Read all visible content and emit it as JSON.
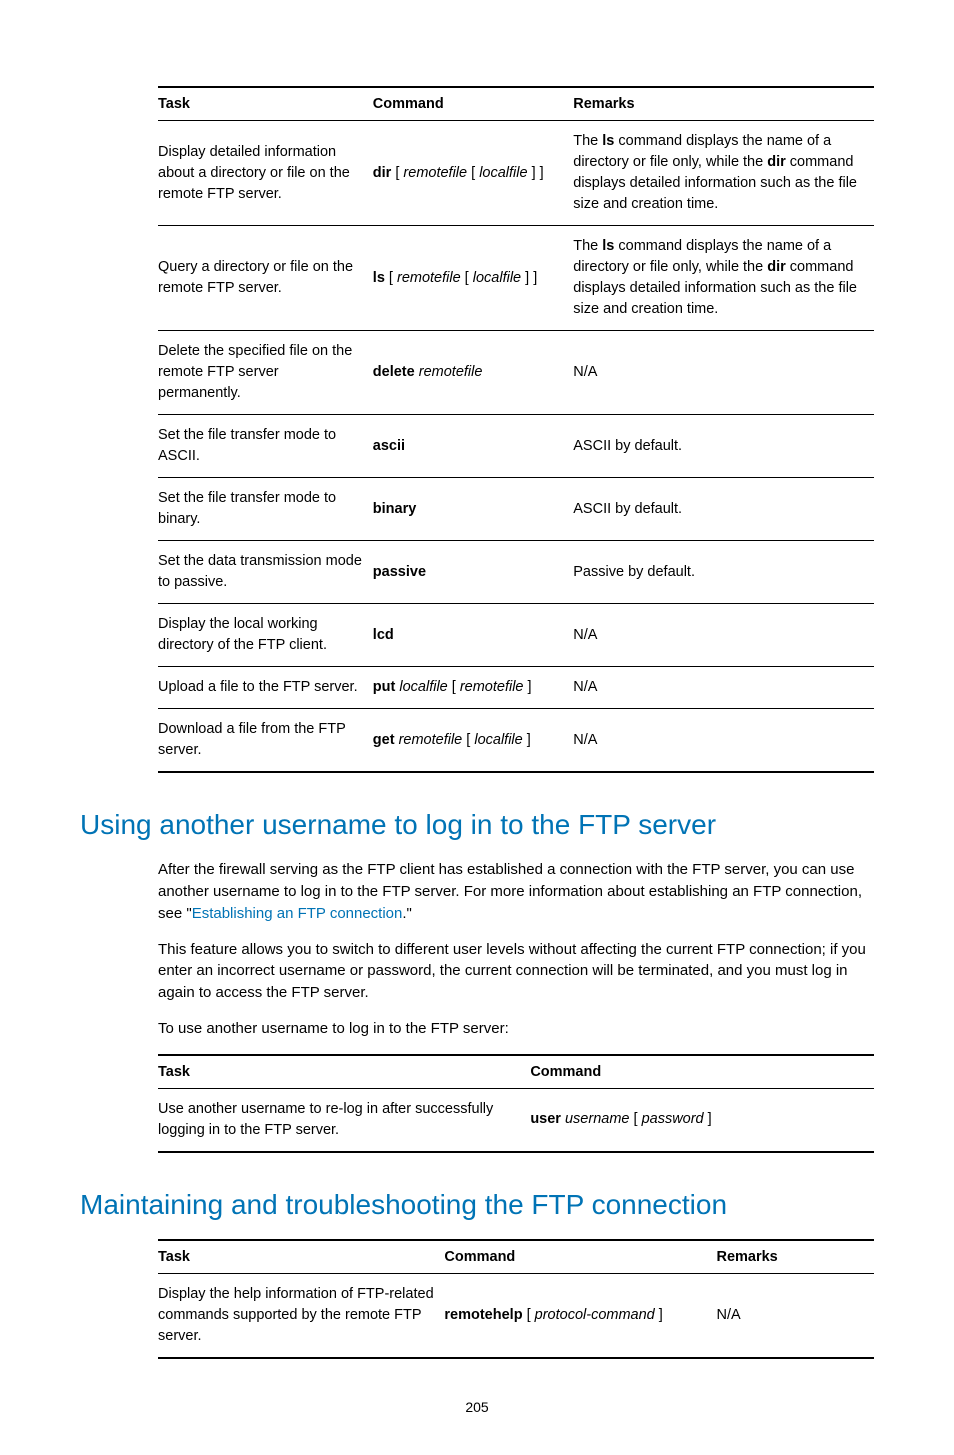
{
  "table1": {
    "headers": [
      "Task",
      "Command",
      "Remarks"
    ],
    "rows": [
      {
        "task": "Display detailed information about a directory or file on the remote FTP server.",
        "cmd_bold": "dir",
        "cmd_rest_html": " [ <span class=\"ital\">remotefile</span> [ <span class=\"ital\">localfile</span> ] ]",
        "remarks_html": "The <span class=\"bold\">ls</span> command displays the name of a directory or file only, while the <span class=\"bold\">dir</span> command displays detailed information such as the file size and creation time."
      },
      {
        "task": "Query a directory or file on the remote FTP server.",
        "cmd_bold": "ls",
        "cmd_rest_html": " [ <span class=\"ital\">remotefile</span> [ <span class=\"ital\">localfile</span> ] ]",
        "remarks_html": "The <span class=\"bold\">ls</span> command displays the name of a directory or file only, while the <span class=\"bold\">dir</span> command displays detailed information such as the file size and creation time."
      },
      {
        "task": "Delete the specified file on the remote FTP server permanently.",
        "cmd_bold": "delete",
        "cmd_rest_html": " <span class=\"ital\">remotefile</span>",
        "remarks_html": "N/A"
      },
      {
        "task": "Set the file transfer mode to ASCII.",
        "cmd_bold": "ascii",
        "cmd_rest_html": "",
        "remarks_html": "ASCII by default."
      },
      {
        "task": "Set the file transfer mode to binary.",
        "cmd_bold": "binary",
        "cmd_rest_html": "",
        "remarks_html": "ASCII by default."
      },
      {
        "task": "Set the data transmission mode to passive.",
        "cmd_bold": "passive",
        "cmd_rest_html": "",
        "remarks_html": "Passive by default."
      },
      {
        "task": "Display the local working directory of the FTP client.",
        "cmd_bold": "lcd",
        "cmd_rest_html": "",
        "remarks_html": "N/A"
      },
      {
        "task": "Upload a file to the FTP server.",
        "cmd_bold": "put",
        "cmd_rest_html": " <span class=\"ital\">localfile</span> [ <span class=\"ital\">remotefile</span> ]",
        "remarks_html": "N/A"
      },
      {
        "task": "Download a file from the FTP server.",
        "cmd_bold": "get",
        "cmd_rest_html": " <span class=\"ital\">remotefile</span> [ <span class=\"ital\">localfile</span> ]",
        "remarks_html": "N/A"
      }
    ]
  },
  "section1": {
    "heading": "Using another username to log in to the FTP server",
    "para1_pre": "After the firewall serving as the FTP client has established a connection with the FTP server, you can use another username to log in to the FTP server. For more information about establishing an FTP connection, see \"",
    "para1_link": "Establishing an FTP connection",
    "para1_post": ".\"",
    "para2": "This feature allows you to switch to different user levels without affecting the current FTP connection; if you enter an incorrect username or password, the current connection will be terminated, and you must log in again to access the FTP server.",
    "para3": "To use another username to log in to the FTP server:"
  },
  "table2": {
    "headers": [
      "Task",
      "Command"
    ],
    "row": {
      "task": "Use another username to re-log in after successfully logging in to the FTP server.",
      "cmd_bold": "user",
      "cmd_rest_html": " <span class=\"ital\">username</span> [ <span class=\"ital\">password</span> ]"
    }
  },
  "section2": {
    "heading": "Maintaining and troubleshooting the FTP connection"
  },
  "table3": {
    "headers": [
      "Task",
      "Command",
      "Remarks"
    ],
    "row": {
      "task": "Display the help information of FTP-related commands supported by the remote FTP server.",
      "cmd_bold": "remotehelp",
      "cmd_rest_html": " [ <span class=\"ital\">protocol-command</span> ]",
      "remarks": "N/A"
    }
  },
  "page_number": "205"
}
